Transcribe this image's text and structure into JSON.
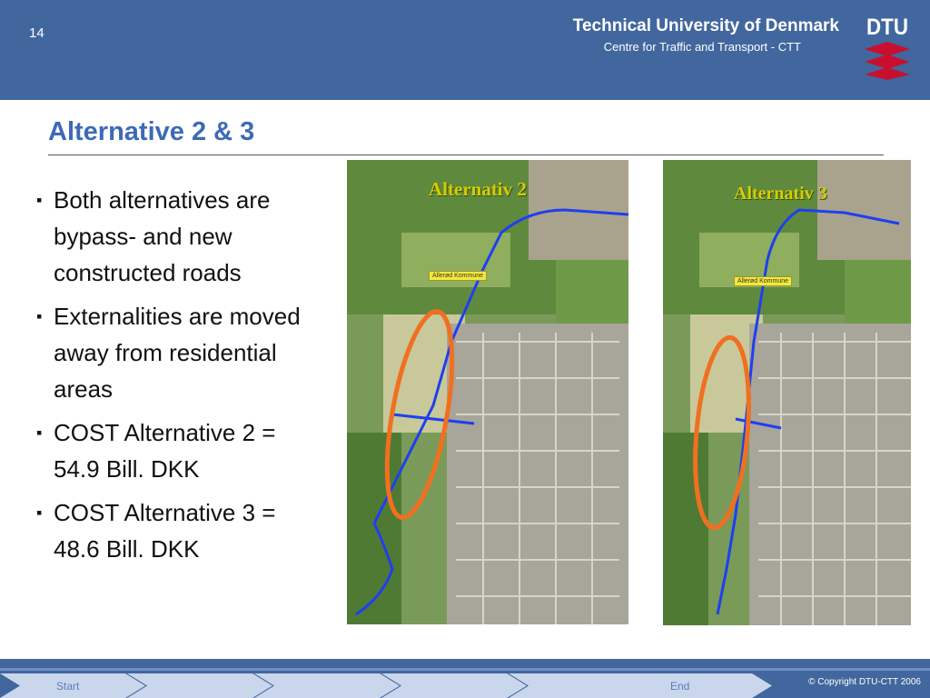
{
  "header": {
    "page_number": "14",
    "university": "Technical University of Denmark",
    "centre": "Centre for Traffic and Transport - CTT",
    "logo_text": "DTU"
  },
  "slide": {
    "title": "Alternative 2 & 3",
    "bullets": [
      "Both alternatives are bypass- and new constructed roads",
      "Externalities are moved away from residential areas",
      "COST Alternative 2 = 54.9 Bill. DKK",
      "COST Alternative 3 = 48.6 Bill. DKK"
    ]
  },
  "maps": {
    "left": {
      "label": "Alternativ 2",
      "town_label": "Allerød Kommune"
    },
    "right": {
      "label": "Alternativ 3",
      "town_label": "Allerød Kommune"
    }
  },
  "footer": {
    "nav": {
      "start": "Start",
      "end": "End"
    },
    "copyright": "© Copyright DTU-CTT 2006"
  },
  "colors": {
    "header_bg": "#41679e",
    "title_color": "#3d6ab8",
    "route_blue": "#1f3ff0",
    "ring_orange": "#f07020",
    "logo_red": "#c8102e"
  }
}
